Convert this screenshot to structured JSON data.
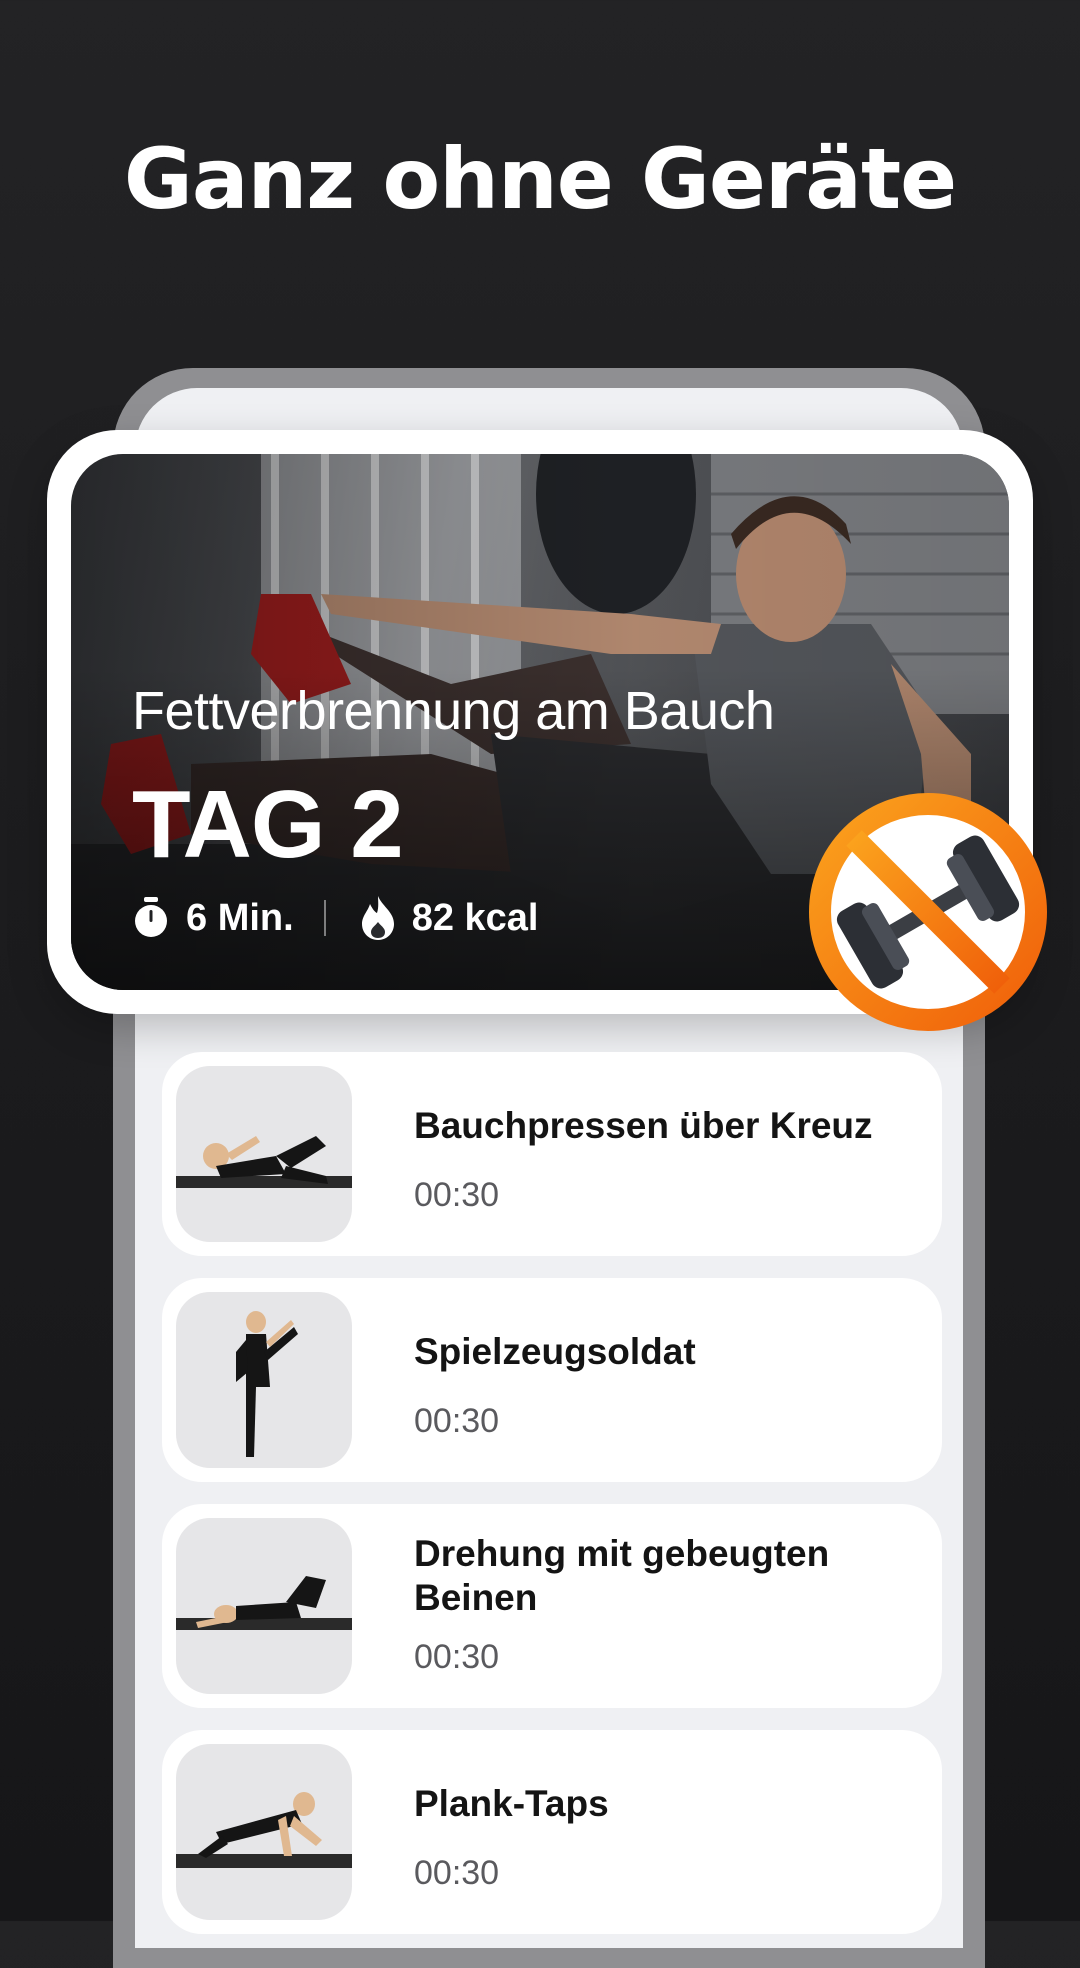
{
  "headline": "Ganz ohne Geräte",
  "hero": {
    "subtitle": "Fettverbrennung am Bauch",
    "day": "TAG 2",
    "duration": "6 Min.",
    "calories": "82 kcal"
  },
  "exercises": [
    {
      "name": "Bauchpressen über Kreuz",
      "time": "00:30"
    },
    {
      "name": "Spielzeugsoldat",
      "time": "00:30"
    },
    {
      "name": "Drehung mit gebeugten Beinen",
      "time": "00:30"
    },
    {
      "name": "Plank-Taps",
      "time": "00:30"
    }
  ],
  "icons": {
    "duration": "stopwatch-icon",
    "calories": "flame-icon",
    "badge": "no-dumbbell-icon"
  },
  "colors": {
    "background": "#1c1c1e",
    "badge_orange": "#f47a0b",
    "text_dark": "#141414",
    "text_muted": "#5a5a5e"
  }
}
